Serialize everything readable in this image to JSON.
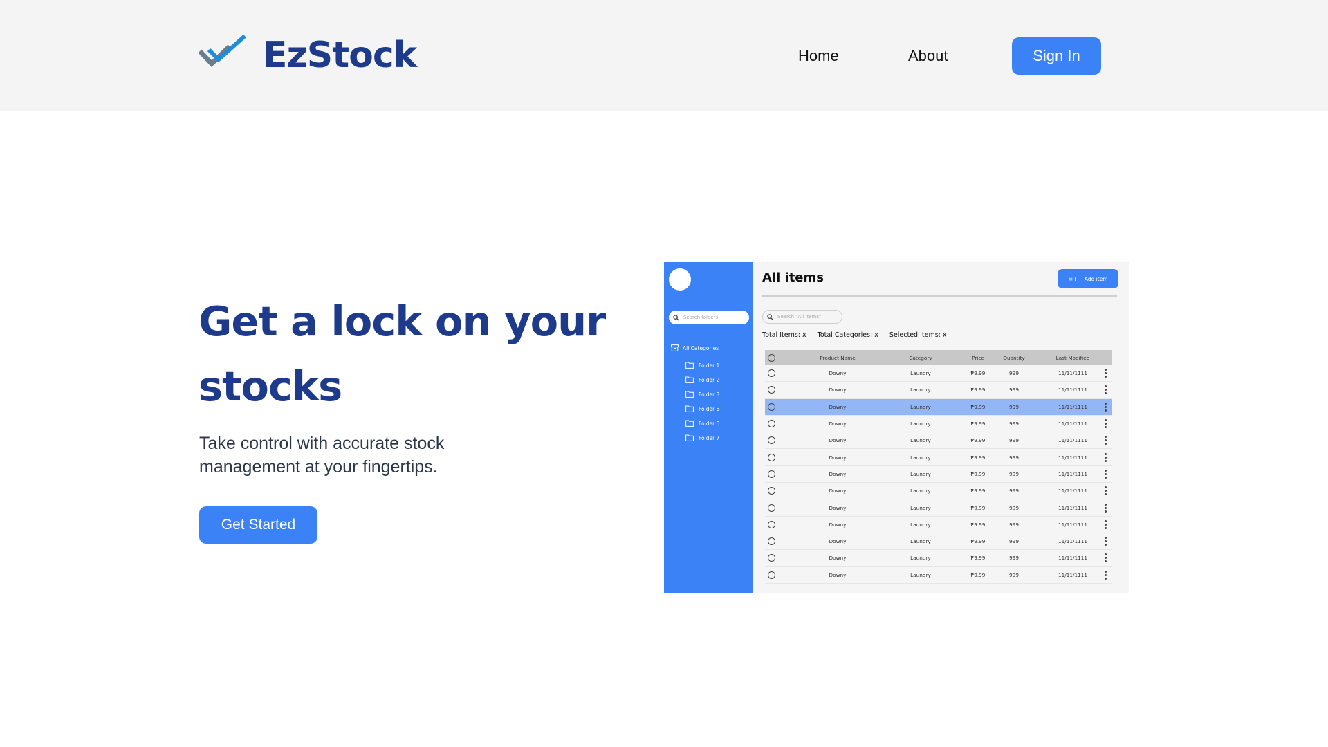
{
  "header": {
    "brand": "EzStock",
    "nav": [
      {
        "label": "Home"
      },
      {
        "label": "About"
      }
    ],
    "signin_label": "Sign In",
    "colors": {
      "accent": "#3b82f6",
      "brand": "#1e3a8a",
      "header_bg": "#f4f4f4"
    }
  },
  "hero": {
    "title": "Get a lock on your stocks",
    "subtitle": "Take control with accurate stock management at your fingertips.",
    "cta_label": "Get Started"
  },
  "mockup": {
    "sidebar": {
      "search_placeholder": "Search folders",
      "all_categories": "All Categories",
      "folders": [
        "Folder 1",
        "Folder 2",
        "Folder 3",
        "Folder 5",
        "Folder 6",
        "Folder 7"
      ]
    },
    "title": "All items",
    "add_label": "Add item",
    "search_placeholder": "Search \"All Items\"",
    "stats": {
      "total_items": "Total Items: x",
      "total_categories": "Total Categories: x",
      "selected_items": "Selected Items: x"
    },
    "table": {
      "columns": [
        "Product Name",
        "Category",
        "Price",
        "Quantity",
        "Last Modified"
      ],
      "selected_row": 2,
      "rows": [
        [
          "Downy",
          "Laundry",
          "₱9.99",
          "999",
          "11/11/1111"
        ],
        [
          "Downy",
          "Laundry",
          "₱9.99",
          "999",
          "11/11/1111"
        ],
        [
          "Downy",
          "Laundry",
          "₱9.99",
          "999",
          "11/11/1111"
        ],
        [
          "Downy",
          "Laundry",
          "₱9.99",
          "999",
          "11/11/1111"
        ],
        [
          "Downy",
          "Laundry",
          "₱9.99",
          "999",
          "11/11/1111"
        ],
        [
          "Downy",
          "Laundry",
          "₱9.99",
          "999",
          "11/11/1111"
        ],
        [
          "Downy",
          "Laundry",
          "₱9.99",
          "999",
          "11/11/1111"
        ],
        [
          "Downy",
          "Laundry",
          "₱9.99",
          "999",
          "11/11/1111"
        ],
        [
          "Downy",
          "Laundry",
          "₱9.99",
          "999",
          "11/11/1111"
        ],
        [
          "Downy",
          "Laundry",
          "₱9.99",
          "999",
          "11/11/1111"
        ],
        [
          "Downy",
          "Laundry",
          "₱9.99",
          "999",
          "11/11/1111"
        ],
        [
          "Downy",
          "Laundry",
          "₱9.99",
          "999",
          "11/11/1111"
        ],
        [
          "Downy",
          "Laundry",
          "₱9.99",
          "999",
          "11/11/1111"
        ]
      ]
    },
    "icons": [
      "avatar",
      "search-icon",
      "archive-icon",
      "folder-icon",
      "add-list-icon",
      "kebab-menu-icon"
    ]
  }
}
